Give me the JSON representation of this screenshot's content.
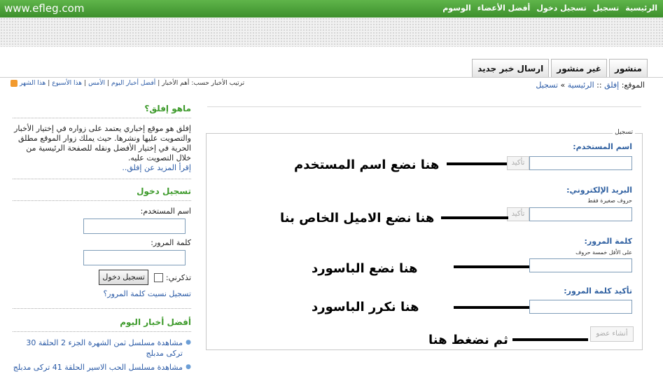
{
  "site_url": "www.efleg.com",
  "topnav": [
    "الرئيسية",
    "تسجيل",
    "تسجيل دخول",
    "أفضل الأعضاء",
    "الوسوم"
  ],
  "tabs": [
    "منشور",
    "غير منشور",
    "ارسال خبر جديد"
  ],
  "breadcrumb": {
    "prefix": "الموقع:",
    "site": "إفلق",
    "sep1": "::",
    "home": "الرئيسية",
    "sep2": "»",
    "current": "تسجيل"
  },
  "sort": {
    "label": "ترتيب الأخبار حسب:",
    "items": [
      "أهم الأخبار",
      "أفضل أخبار اليوم",
      "الأمس",
      "هذا الأسبوع",
      "هذا الشهر"
    ]
  },
  "sidebar": {
    "about_title": "ماهو إفلق؟",
    "about_text": "إفلق هو موقع إخباري يعتمد على زواره في إختيار الأخبار والتصويت عليها ونشرها. حيث يملك زوار الموقع مطلق الحرية في إختيار الأفضل ونقله للصفحة الرئيسية من خلال التصويت عليه.",
    "about_more": "إقرأ المزيد عن إفلق..",
    "login_title": "تسجيل دخول",
    "username_label": "اسم المستخدم:",
    "password_label": "كلمة المرور:",
    "remember_label": "تذكرني:",
    "login_button": "تسجيل دخول",
    "links": "تسجيل نسيت كلمة المرور؟",
    "best_title": "أفضل أخبار اليوم",
    "best_items": [
      "مشاهدة مسلسل ثمن الشهرة الجزء 2 الحلقة 30 تركى مدبلج",
      "مشاهدة مسلسل الحب الاسير الحلقة 41 تركى مدبلج"
    ]
  },
  "register": {
    "legend": "تسجيل",
    "username_label": "اسم المستخدم:",
    "email_label": "البريد الإلكتروني:",
    "email_hint": "حروف صغيرة فقط",
    "password_label": "كلمة المرور:",
    "password_hint": "على الأقل خمسة حروف",
    "confirm_label": "تأكيد كلمة المرور:",
    "check_button": "تأكيد",
    "create_button": "أنشاء عضو"
  },
  "annotations": {
    "username": "هنا نضع اسم المستخدم",
    "email": "هنا نضع الاميل الخاص بنا",
    "password": "هنا نضع الباسورد",
    "confirm": "هنا نكرر الباسورد",
    "submit": "ثم نضغط هنا"
  }
}
